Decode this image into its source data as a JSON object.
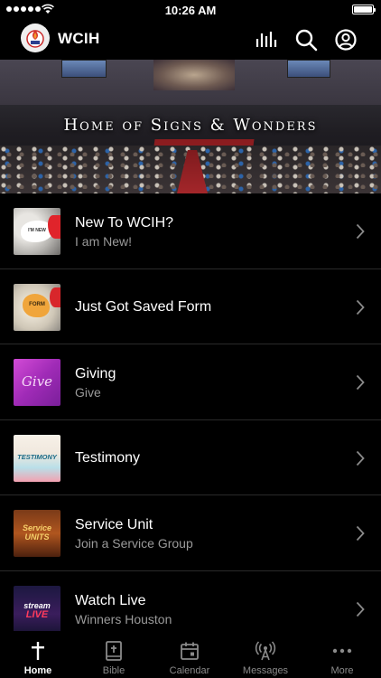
{
  "status_bar": {
    "time": "10:26 AM"
  },
  "header": {
    "title": "WCIH"
  },
  "hero": {
    "caption": "Home of Signs & Wonders"
  },
  "menu": [
    {
      "title": "New To WCIH?",
      "subtitle": "I am New!",
      "thumb_text": "I'M NEW"
    },
    {
      "title": "Just Got Saved Form",
      "subtitle": "",
      "thumb_text": "FORM"
    },
    {
      "title": "Giving",
      "subtitle": "Give",
      "thumb_text": "Give"
    },
    {
      "title": "Testimony",
      "subtitle": "",
      "thumb_text": "TESTIMONY"
    },
    {
      "title": "Service Unit",
      "subtitle": "Join a Service Group",
      "thumb_text": "Service UNITS"
    },
    {
      "title": "Watch Live",
      "subtitle": "Winners Houston",
      "thumb_text": "stream",
      "thumb_text_2": "LIVE"
    }
  ],
  "tabs": [
    {
      "label": "Home",
      "icon": "cross-icon"
    },
    {
      "label": "Bible",
      "icon": "bible-icon"
    },
    {
      "label": "Calendar",
      "icon": "calendar-icon"
    },
    {
      "label": "Messages",
      "icon": "broadcast-icon"
    },
    {
      "label": "More",
      "icon": "more-dots-icon"
    }
  ],
  "colors": {
    "background": "#000000",
    "text": "#ffffff",
    "subtext": "#9a9a9a",
    "inactive_tab": "#8a8a8a"
  }
}
